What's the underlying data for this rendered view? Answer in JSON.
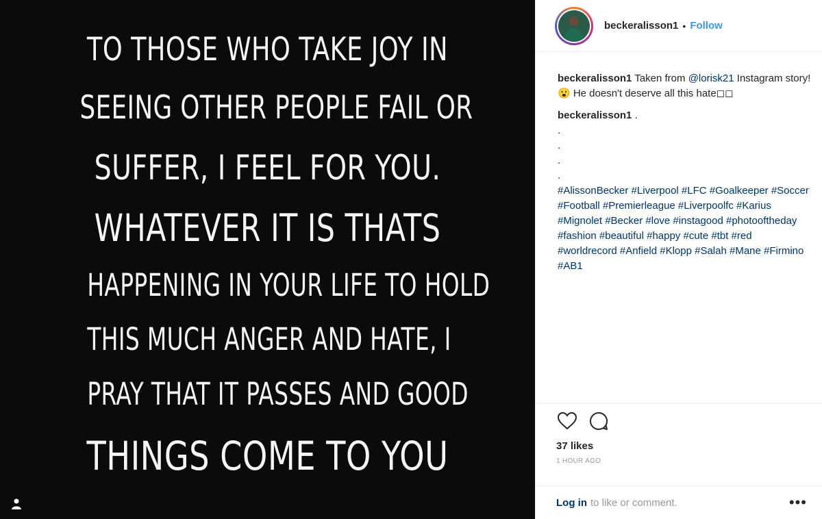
{
  "media": {
    "quote_lines": [
      "TO THOSE WHO TAKE JOY IN",
      "SEEING OTHER PEOPLE FAIL OR",
      "SUFFER, I FEEL FOR YOU.",
      "WHATEVER IT IS THATS",
      "HAPPENING IN YOUR LIFE TO HOLD",
      "THIS MUCH ANGER AND HATE, I",
      "PRAY THAT IT PASSES AND GOOD",
      "THINGS COME TO YOU"
    ],
    "background_color": "#0b0b0b",
    "tag_icon": "person-tag-icon"
  },
  "header": {
    "username": "beckeralisson1",
    "separator": "•",
    "follow_label": "Follow"
  },
  "caption": {
    "username": "beckeralisson1",
    "text_before": "Taken from",
    "mention": "@lorisk21",
    "text_after": "Instagram story! 😮 He doesn't deserve all this hate◻◻"
  },
  "comment": {
    "username": "beckeralisson1",
    "text": ".",
    "dots": [
      ".",
      ".",
      ".",
      "."
    ],
    "hashtags": "#AlissonBecker #Liverpool #LFC #Goalkeeper #Soccer #Football #Premierleague #Liverpoolfc #Karius #Mignolet #Becker #love #instagood #photooftheday #fashion #beautiful #happy #cute #tbt #red #worldrecord #Anfield #Klopp #Salah #Mane #Firmino #AB1"
  },
  "actions": {
    "like_icon": "heart-icon",
    "comment_icon": "comment-icon",
    "likes": "37 likes",
    "time": "1 HOUR AGO"
  },
  "footer": {
    "login_label": "Log in",
    "login_suffix": "to like or comment.",
    "more_label": "•••"
  },
  "colors": {
    "link": "#003569",
    "follow": "#3897f0",
    "text": "#262626",
    "muted": "#999999"
  }
}
